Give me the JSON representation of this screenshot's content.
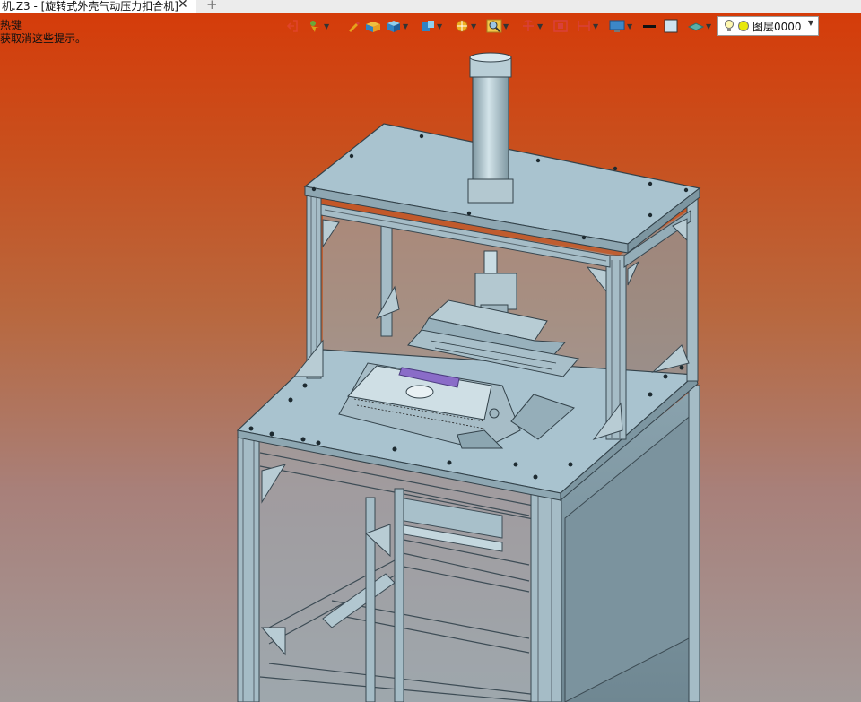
{
  "tab": {
    "title": "机.Z3 - [旋转式外壳气动压力扣合机]",
    "close_glyph": "✕",
    "add_glyph": "+"
  },
  "hint": {
    "line1": "热键",
    "line2": "获取消这些提示。"
  },
  "toolbar": {
    "tools": [
      {
        "icon": "exit-icon"
      },
      {
        "icon": "pointer-filter-icon"
      },
      {
        "icon": "pencil-icon"
      },
      {
        "icon": "shade-box-icon"
      },
      {
        "icon": "cube-view-icon"
      },
      {
        "icon": "view-orient-icon"
      },
      {
        "icon": "render-icon"
      },
      {
        "icon": "zoom-icon"
      },
      {
        "icon": "rotate-icon"
      },
      {
        "icon": "zoom-box-icon"
      },
      {
        "icon": "section-icon"
      },
      {
        "icon": "display-monitor-icon"
      },
      {
        "icon": "line-color-icon"
      },
      {
        "icon": "face-color-icon"
      },
      {
        "icon": "material-icon"
      }
    ],
    "layer": {
      "name": "图层0000",
      "bulb_icon": "lightbulb-icon",
      "dot_color": "#e8e80c"
    }
  },
  "colors": {
    "bg_top": "#d63a08",
    "bg_bottom": "#a39a99",
    "frame": "#9fb4bf",
    "plate_top": "#a9c3cf",
    "panel": "#7f98a3",
    "lcd": "#8a6cc8"
  }
}
